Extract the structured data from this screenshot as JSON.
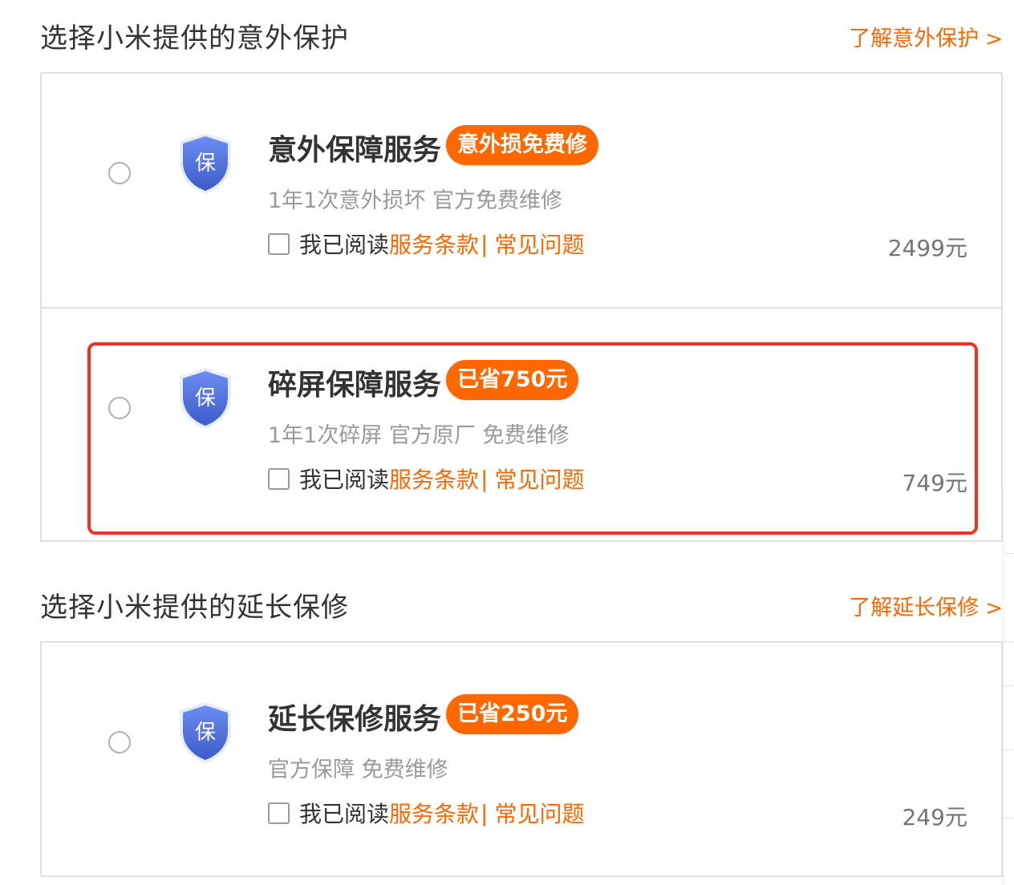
{
  "accident_section": {
    "title": "选择小米提供的意外保护",
    "learn_more": "了解意外保护",
    "chevron": ">"
  },
  "extended_section": {
    "title": "选择小米提供的延长保修",
    "learn_more": "了解延长保修",
    "chevron": ">"
  },
  "shield_icon": {
    "icon": "shield-icon",
    "glyph": "保",
    "color_top": "#6b8df0",
    "color_bottom": "#3e5bc9"
  },
  "agree": {
    "prefix": "我已阅读",
    "terms": "服务条款",
    "separator": "|",
    "faq": "常见问题"
  },
  "options": [
    {
      "name": "意外保障服务",
      "badge": "意外损免费修",
      "desc": "1年1次意外损坏 官方免费维修",
      "price": "2499元",
      "highlighted": false
    },
    {
      "name": "碎屏保障服务",
      "badge": "已省750元",
      "desc": "1年1次碎屏 官方原厂 免费维修",
      "price": "749元",
      "highlighted": true
    },
    {
      "name": "延长保修服务",
      "badge": "已省250元",
      "desc": "官方保障 免费维修",
      "price": "249元",
      "highlighted": false
    }
  ],
  "colors": {
    "accent": "#ff6700",
    "highlight_border": "#ee3324",
    "text": "#333333",
    "muted": "#9a9a9a",
    "border": "#e0e0e0"
  }
}
